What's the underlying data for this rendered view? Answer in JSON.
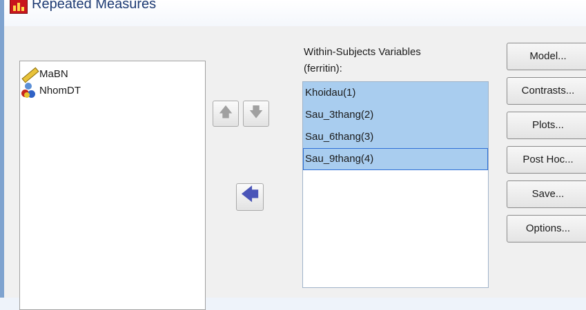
{
  "window": {
    "title": "Repeated Measures"
  },
  "variables": [
    {
      "name": "MaBN",
      "icon": "ruler-icon"
    },
    {
      "name": "NhomDT",
      "icon": "nominal-icon"
    }
  ],
  "move_buttons": {
    "up": "🡅",
    "down": "🡇",
    "move": "🡄"
  },
  "within_subjects": {
    "label_line1": "Within-Subjects Variables",
    "label_line2": "(ferritin):",
    "items": [
      "Khoidau(1)",
      "Sau_3thang(2)",
      "Sau_6thang(3)",
      "Sau_9thang(4)"
    ]
  },
  "side_buttons": {
    "model": "Model...",
    "contrasts": "Contrasts...",
    "plots": "Plots...",
    "post_hoc": "Post Hoc...",
    "save": "Save...",
    "options": "Options..."
  },
  "colors": {
    "selection": "#a9cdef",
    "accent": "#2f6fd6"
  }
}
